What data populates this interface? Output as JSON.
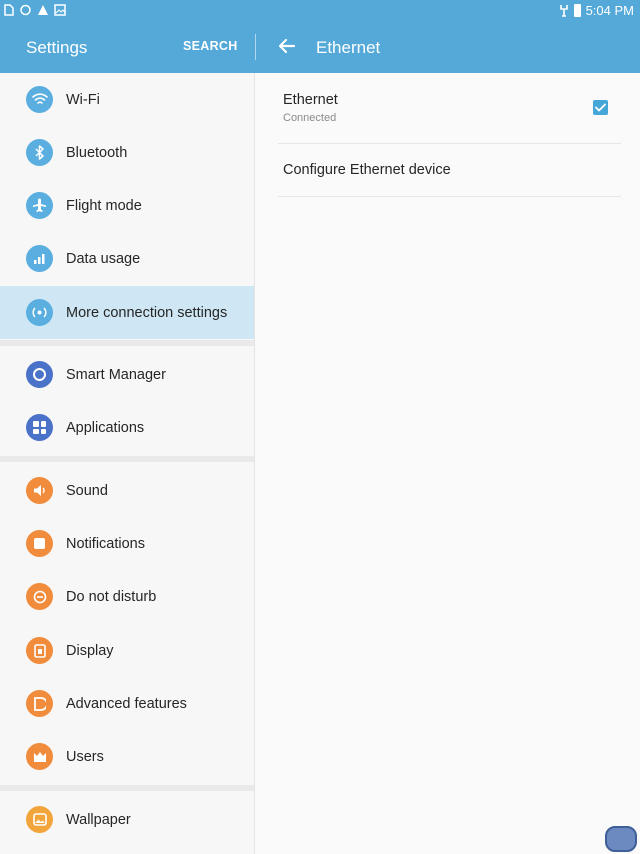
{
  "status_bar": {
    "time": "5:04 PM"
  },
  "app_bar": {
    "title": "Settings",
    "search_label": "SEARCH",
    "detail_title": "Ethernet"
  },
  "sidebar": {
    "items": [
      {
        "label": "Wi-Fi",
        "icon": "wifi-icon",
        "color": "#5aaee0"
      },
      {
        "label": "Bluetooth",
        "icon": "bluetooth-icon",
        "color": "#5aaee0"
      },
      {
        "label": "Flight mode",
        "icon": "airplane-icon",
        "color": "#5aaee0"
      },
      {
        "label": "Data usage",
        "icon": "data-usage-icon",
        "color": "#5aaee0"
      },
      {
        "label": "More connection settings",
        "icon": "connection-icon",
        "color": "#5aaee0",
        "selected": true
      },
      {
        "label": "Smart Manager",
        "icon": "smart-manager-icon",
        "color": "#4a72c8"
      },
      {
        "label": "Applications",
        "icon": "applications-icon",
        "color": "#4a72c8"
      },
      {
        "label": "Sound",
        "icon": "sound-icon",
        "color": "#f08c3b"
      },
      {
        "label": "Notifications",
        "icon": "notifications-icon",
        "color": "#f08c3b"
      },
      {
        "label": "Do not disturb",
        "icon": "do-not-disturb-icon",
        "color": "#f08c3b"
      },
      {
        "label": "Display",
        "icon": "display-icon",
        "color": "#f08c3b"
      },
      {
        "label": "Advanced features",
        "icon": "advanced-features-icon",
        "color": "#f08c3b"
      },
      {
        "label": "Users",
        "icon": "users-icon",
        "color": "#f08c3b"
      },
      {
        "label": "Wallpaper",
        "icon": "wallpaper-icon",
        "color": "#f2a53a"
      }
    ]
  },
  "detail": {
    "ethernet_title": "Ethernet",
    "ethernet_status": "Connected",
    "ethernet_enabled": true,
    "configure_label": "Configure Ethernet device"
  },
  "colors": {
    "accent": "#54a9d9",
    "selected_bg": "#cfe7f4",
    "checkbox": "#45a6d8"
  }
}
